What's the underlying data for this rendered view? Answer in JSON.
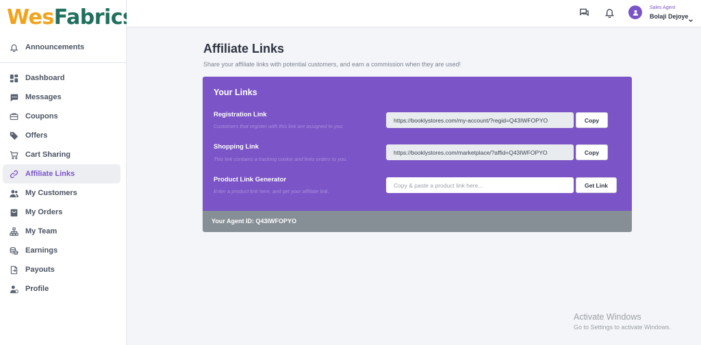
{
  "brand": {
    "part1": "Wes",
    "part2": "Fabrics"
  },
  "sidebar": {
    "top_item": {
      "label": "Announcements",
      "icon": "bell-icon"
    },
    "items": [
      {
        "label": "Dashboard",
        "icon": "dashboard-icon",
        "active": false
      },
      {
        "label": "Messages",
        "icon": "chat-icon",
        "active": false
      },
      {
        "label": "Coupons",
        "icon": "coupon-icon",
        "active": false
      },
      {
        "label": "Offers",
        "icon": "tag-icon",
        "active": false
      },
      {
        "label": "Cart Sharing",
        "icon": "cart-icon",
        "active": false
      },
      {
        "label": "Affiliate Links",
        "icon": "link-icon",
        "active": true
      },
      {
        "label": "My Customers",
        "icon": "users-icon",
        "active": false
      },
      {
        "label": "My Orders",
        "icon": "orders-icon",
        "active": false
      },
      {
        "label": "My Team",
        "icon": "team-icon",
        "active": false
      },
      {
        "label": "Earnings",
        "icon": "coins-icon",
        "active": false
      },
      {
        "label": "Payouts",
        "icon": "payout-icon",
        "active": false
      },
      {
        "label": "Profile",
        "icon": "profile-icon",
        "active": false
      }
    ]
  },
  "header": {
    "role": "Sales Agent",
    "user_name": "Bolaji Dejoye"
  },
  "page": {
    "title": "Affiliate Links",
    "subtitle": "Share your affiliate links with potential customers, and earn a commission when they are used!"
  },
  "card": {
    "title": "Your Links",
    "rows": [
      {
        "label": "Registration Link",
        "description": "Customers that register with this link are assigned to you.",
        "value": "https://booklystores.com/my-account/?regid=Q43IWFOPYO",
        "button": "Copy"
      },
      {
        "label": "Shopping Link",
        "description": "This link contains a tracking cookie and links orders to you.",
        "value": "https://booklystores.com/marketplace/?affid=Q43IWFOPYO",
        "button": "Copy"
      },
      {
        "label": "Product Link Generator",
        "description": "Enter a product link here, and get your affiliate link.",
        "placeholder": "Copy & paste a product link here...",
        "button": "Get Link"
      }
    ],
    "footer": "Your Agent ID: Q43IWFOPYO"
  },
  "watermark": {
    "line1": "Activate Windows",
    "line2": "Go to Settings to activate Windows."
  },
  "colors": {
    "accent": "#7b54c7",
    "footer": "#868e96",
    "logo_orange": "#f2a31b",
    "logo_green": "#1f6f5c"
  }
}
